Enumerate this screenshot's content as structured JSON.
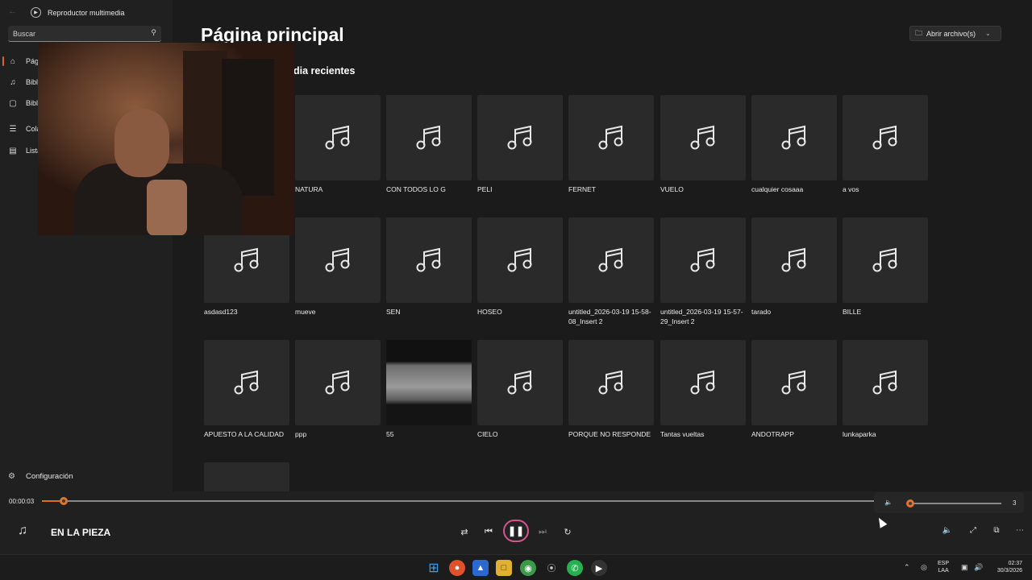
{
  "window": {
    "title": "Reproductor multimedia"
  },
  "sidebar": {
    "search_placeholder": "Buscar",
    "items": [
      {
        "label": "Pág",
        "icon": "home-icon"
      },
      {
        "label": "Bibl",
        "icon": "music-library-icon"
      },
      {
        "label": "Bibl",
        "icon": "video-library-icon"
      },
      {
        "label": "Cola",
        "icon": "queue-icon"
      },
      {
        "label": "Lista",
        "icon": "playlist-icon"
      }
    ],
    "settings_label": "Configuración"
  },
  "main": {
    "title": "Página principal",
    "section_title": "dia recientes",
    "open_button_label": "Abrir archivo(s)",
    "tiles": [
      {
        "name": "NATURA",
        "kind": "music"
      },
      {
        "name": "CON TODOS LO G",
        "kind": "music"
      },
      {
        "name": "PELI",
        "kind": "music"
      },
      {
        "name": "FERNET",
        "kind": "music"
      },
      {
        "name": "VUELO",
        "kind": "music"
      },
      {
        "name": "cualquier cosaaa",
        "kind": "music"
      },
      {
        "name": "a vos",
        "kind": "music"
      },
      {
        "name": "asdasd123",
        "kind": "music"
      },
      {
        "name": "mueve",
        "kind": "music"
      },
      {
        "name": "SEN",
        "kind": "music"
      },
      {
        "name": "HOSEO",
        "kind": "music"
      },
      {
        "name": "untitled_2026-03-19 15-58-08_Insert 2",
        "kind": "music"
      },
      {
        "name": "untitled_2026-03-19 15-57-29_Insert 2",
        "kind": "music"
      },
      {
        "name": "tarado",
        "kind": "music"
      },
      {
        "name": "BILLE",
        "kind": "music"
      },
      {
        "name": "APUESTO A LA CALIDAD",
        "kind": "music"
      },
      {
        "name": "ppp",
        "kind": "music"
      },
      {
        "name": "55",
        "kind": "video"
      },
      {
        "name": "CIELO",
        "kind": "music"
      },
      {
        "name": "PORQUE NO RESPONDE",
        "kind": "music"
      },
      {
        "name": "Tantas vueltas",
        "kind": "music"
      },
      {
        "name": "ANDOTRAPP",
        "kind": "music"
      },
      {
        "name": "lunkaparka",
        "kind": "music"
      },
      {
        "name": "",
        "kind": "blank"
      }
    ]
  },
  "player": {
    "current_time": "00:00:03",
    "progress_fraction": 0.026,
    "volume_value": "3",
    "volume_fraction": 0.03,
    "now_playing": "EN LA PIEZA",
    "state": "playing"
  },
  "taskbar": {
    "lang_top": "ESP",
    "lang_bottom": "LAA",
    "time": "02:37",
    "date": "30/3/2026"
  },
  "colors": {
    "accent": "#e06a2a",
    "play_ring": "#d2568f",
    "background": "#1b1b1b"
  }
}
